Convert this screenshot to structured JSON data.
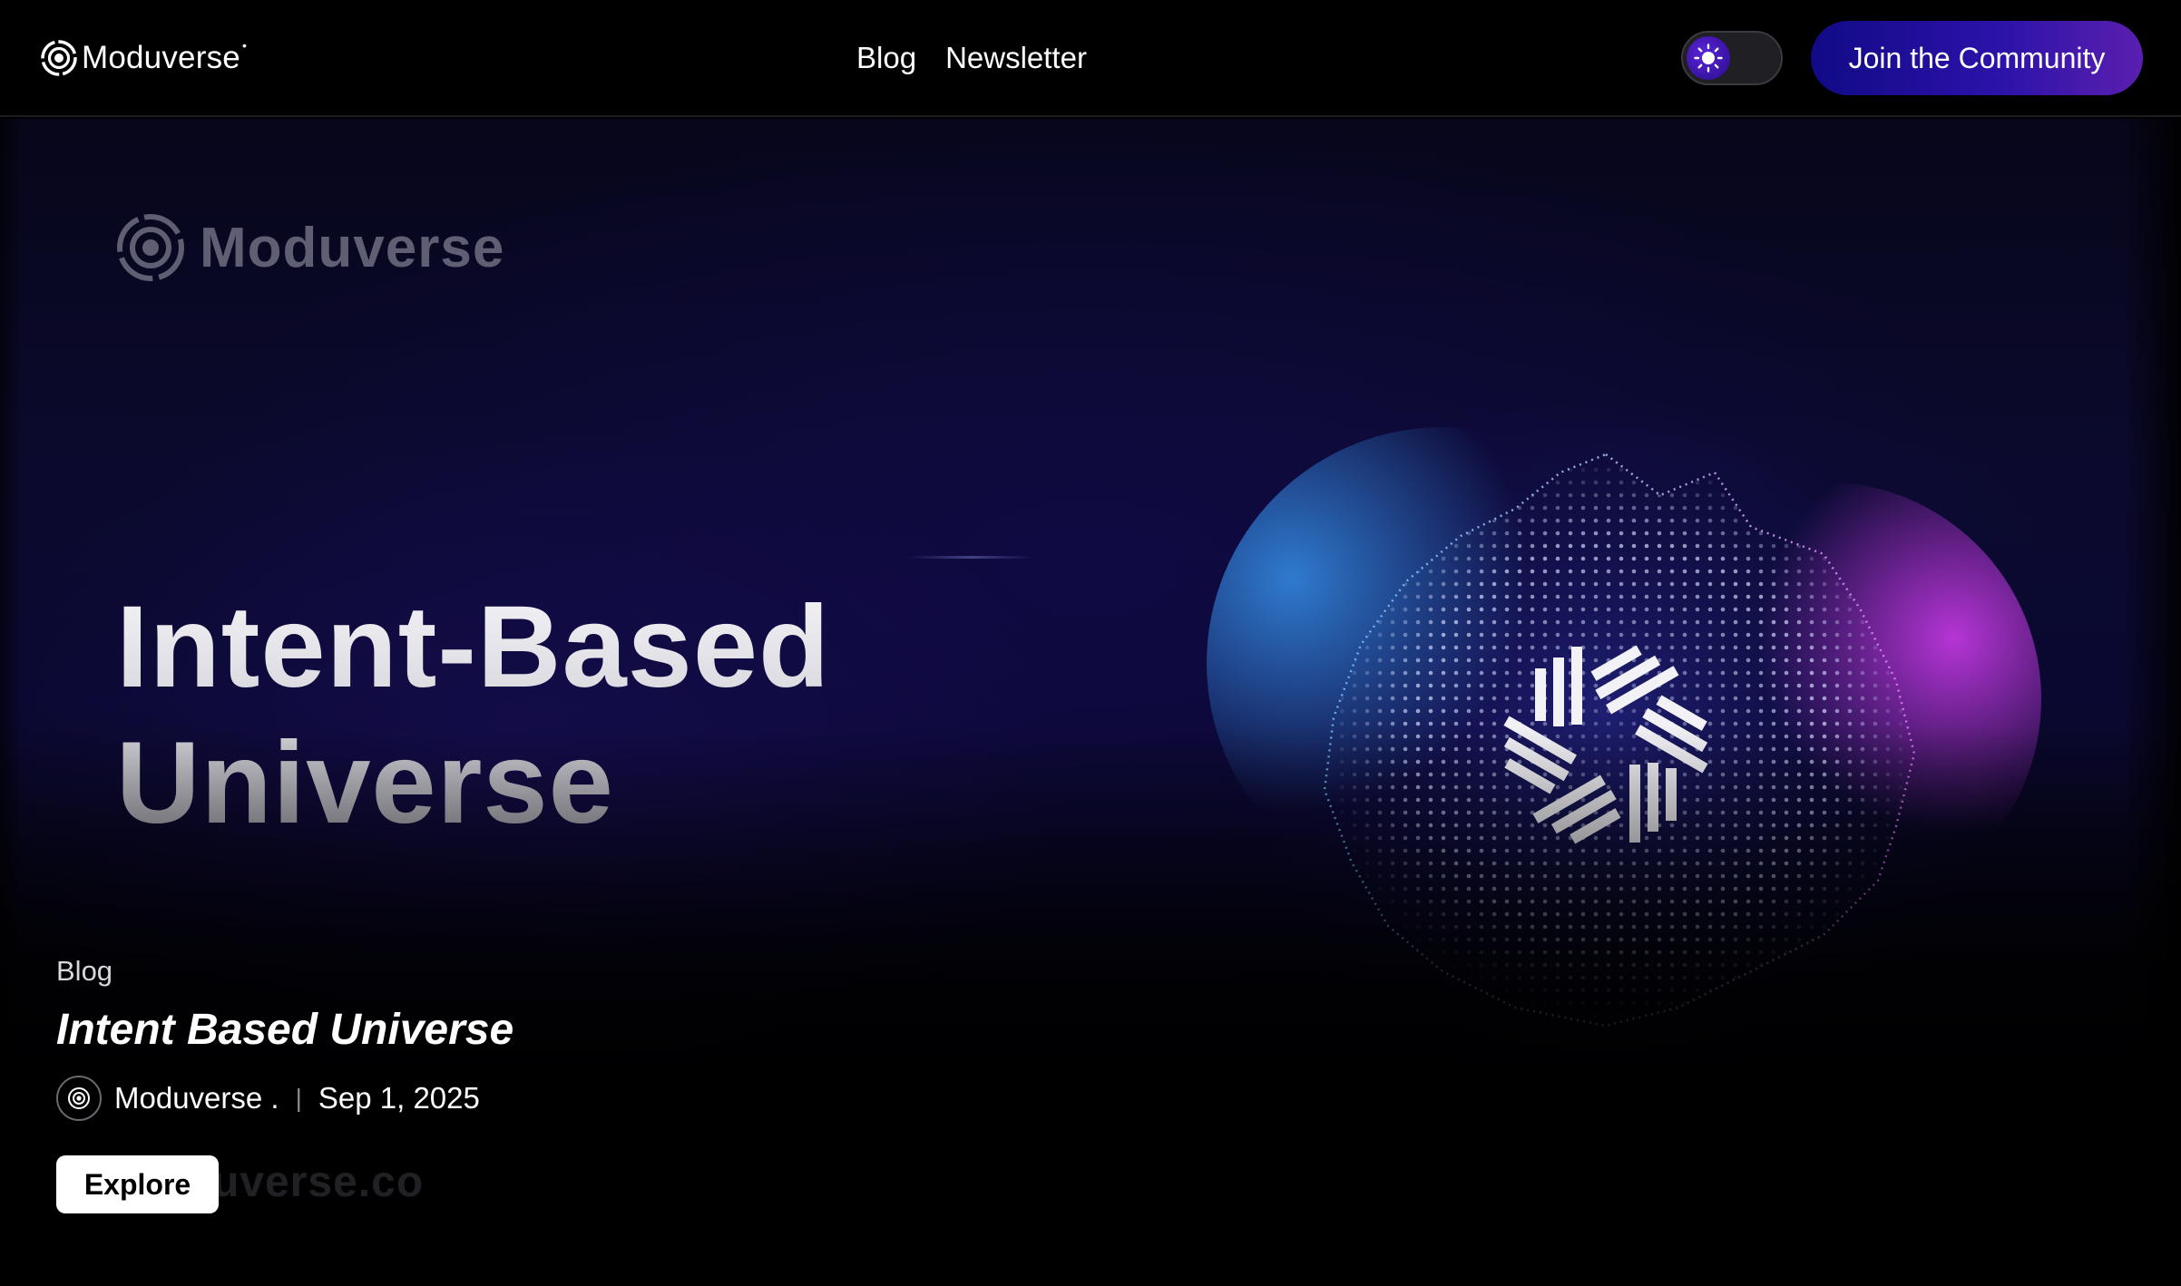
{
  "nav": {
    "brand_name": "Moduverse",
    "brand_mark": "•",
    "brand_icon": "moduverse-logo-icon",
    "links": [
      {
        "label": "Blog"
      },
      {
        "label": "Newsletter"
      }
    ],
    "theme_toggle_icon": "sun-icon",
    "cta_label": "Join the Community"
  },
  "hero": {
    "watermark_brand": "Moduverse",
    "headline_line1": "Intent-Based",
    "headline_line2": "Universe",
    "watermark_url": "uverse.co"
  },
  "post": {
    "category": "Blog",
    "title": "Intent Based Universe",
    "author": "Moduverse .",
    "separator": "|",
    "date": "Sep 1, 2025",
    "explore_label": "Explore"
  },
  "colors": {
    "background": "#000000",
    "cta_start": "#110a86",
    "cta_end": "#5a1fb0",
    "sphere_blue": "#3aa0ff",
    "sphere_magenta": "#e040ff"
  }
}
